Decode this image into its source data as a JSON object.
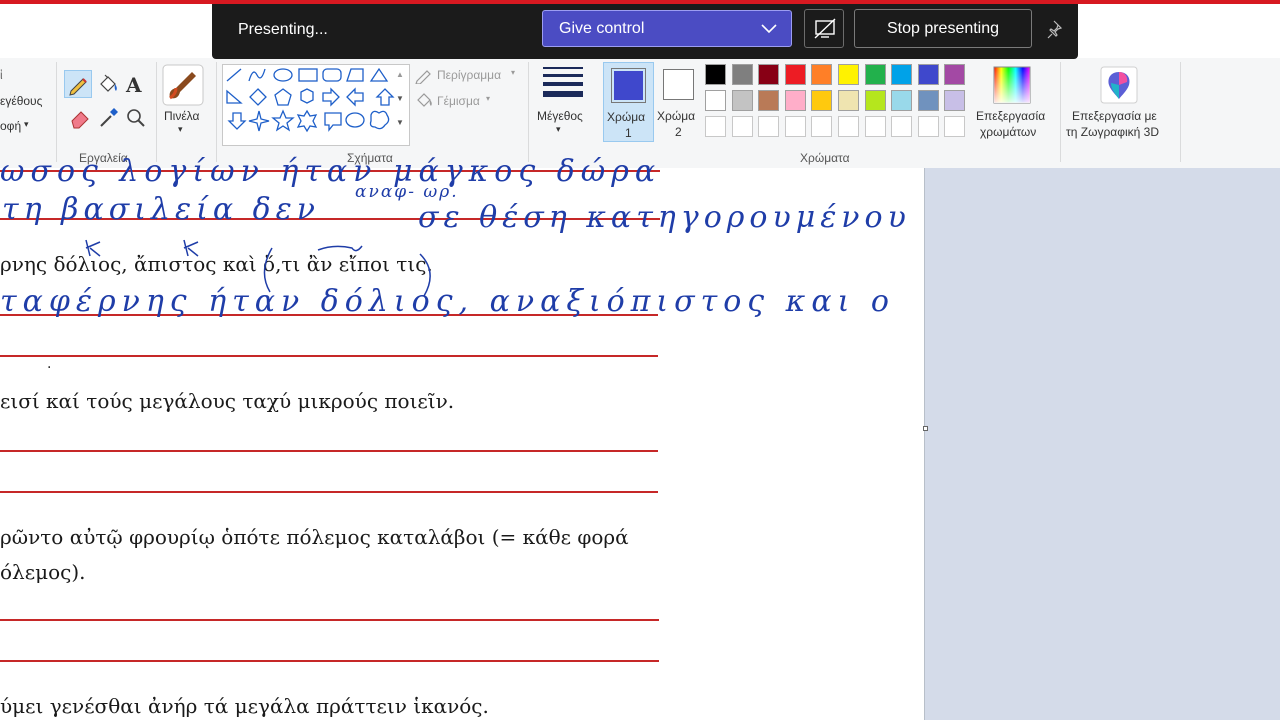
{
  "presenting_bar": {
    "status": "Presenting...",
    "give_control_label": "Give control",
    "stop_label": "Stop presenting"
  },
  "ribbon": {
    "image_labels": {
      "resize": "εγέθους",
      "rotate": "οφή",
      "arrow": "▾"
    },
    "tools_group": "Εργαλεία",
    "brushes_label": "Πινέλα",
    "shapes_group": "Σχήματα",
    "outline_label": "Περίγραμμα",
    "fill_label": "Γέμισμα",
    "size_label": "Μέγεθος",
    "color1_label_line1": "Χρώμα",
    "color1_label_line2": "1",
    "color2_label_line1": "Χρώμα",
    "color2_label_line2": "2",
    "colors_group": "Χρώματα",
    "edit_colors_line1": "Επεξεργασία",
    "edit_colors_line2": "χρωμάτων",
    "paint3d_line1": "Επεξεργασία με",
    "paint3d_line2": "τη Ζωγραφική 3D",
    "color1": "#3f48cc",
    "color2": "#ffffff",
    "palette_row1": [
      "#000000",
      "#7f7f7f",
      "#880015",
      "#ed1c24",
      "#ff7f27",
      "#fff200",
      "#22b14c",
      "#00a2e8",
      "#3f48cc",
      "#a349a4"
    ],
    "palette_row2": [
      "#ffffff",
      "#c3c3c3",
      "#b97a57",
      "#ffaec9",
      "#ffc90e",
      "#efe4b0",
      "#b5e61d",
      "#99d9ea",
      "#7092be",
      "#c8bfe7"
    ]
  },
  "worksheet": {
    "line1": "ρνης δόλιος, ἄπιστος καὶ ὅ,τι ἂν εἴποι τις.",
    "line2": "εισί καί τούς μεγάλους ταχύ μικρούς ποιεῖν.",
    "line3a": "ρῶντο αὐτῷ φρουρίῳ ὁπότε πόλεμος καταλάβοι (= κάθε φορά",
    "line3b": "όλεμος).",
    "line4": "ύμει γενέσθαι ἀνήρ τά μεγάλα πράττειν ἱκανός."
  },
  "handwriting": {
    "h0": "ωσος λογίων ήταν μάγκος δώρα",
    "h1": "τη βασιλεία δεν",
    "h1b": "αναφ-  ωρ.",
    "h1c": "σε θέση κατηγορουμένου",
    "h2": "ταφέρνης ήταν δόλιος, αναξιόπιστος και ο"
  }
}
